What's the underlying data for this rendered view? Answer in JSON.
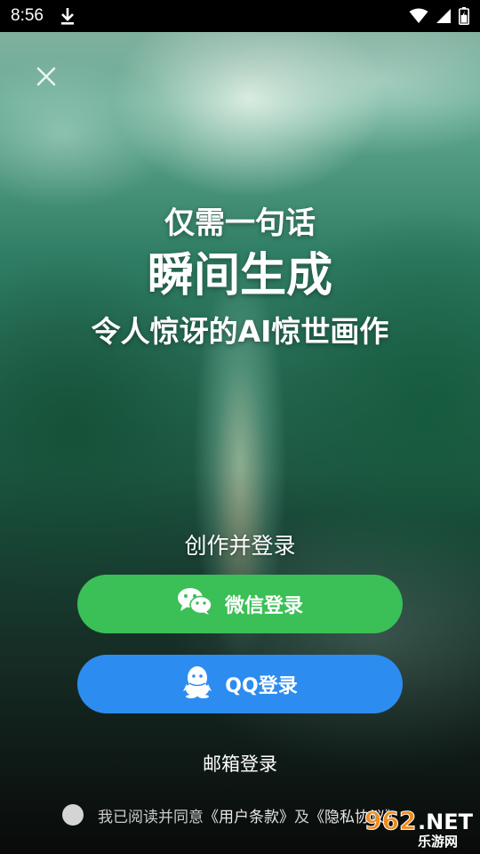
{
  "status_bar": {
    "time": "8:56",
    "icons": [
      "download-icon",
      "wifi-icon",
      "signal-icon",
      "battery-icon"
    ]
  },
  "close": {
    "icon": "close-icon"
  },
  "headline": {
    "line1": "仅需一句话",
    "line2": "瞬间生成",
    "line3": "令人惊讶的AI惊世画作"
  },
  "login": {
    "title": "创作并登录",
    "wechat_label": "微信登录",
    "qq_label": "QQ登录",
    "email_label": "邮箱登录"
  },
  "agreement": {
    "prefix": "我已阅读并同意",
    "user_terms": "《用户条款》",
    "and": "及",
    "privacy": "《隐私协议》"
  },
  "watermark": {
    "number": "962",
    "suffix": ".NET",
    "subtitle": "乐游网"
  },
  "colors": {
    "wechat_button": "#3bbf57",
    "qq_button": "#2d8cf0",
    "status_bar": "#000000"
  }
}
